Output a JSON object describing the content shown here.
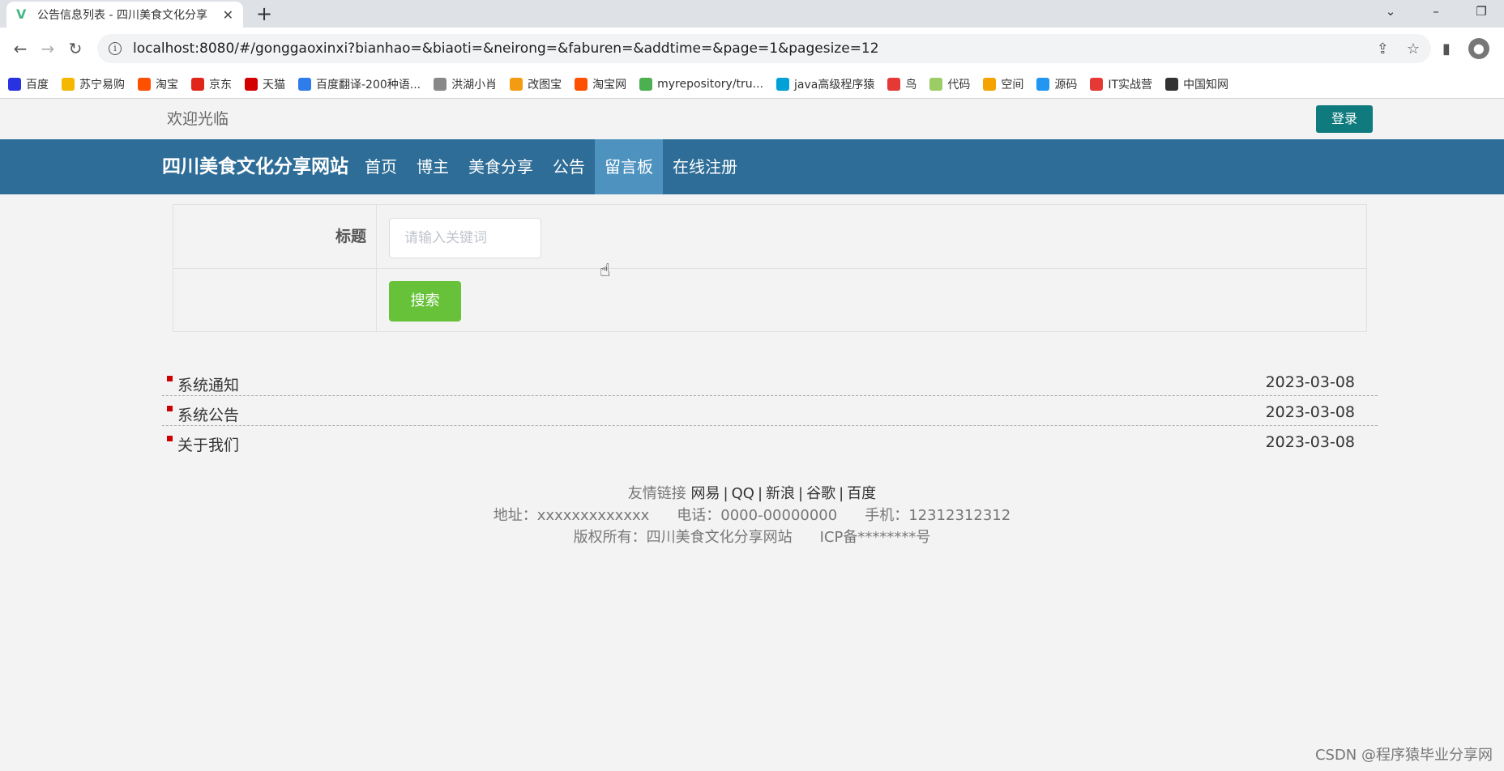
{
  "browser": {
    "tab_title": "公告信息列表 - 四川美食文化分享",
    "new_tab": "+",
    "url": "localhost:8080/#/gonggaoxinxi?bianhao=&biaoti=&neirong=&faburen=&addtime=&page=1&pagesize=12",
    "bookmarks": [
      {
        "label": "百度",
        "color": "#2932e1",
        "icon": "baidu-icon"
      },
      {
        "label": "苏宁易购",
        "color": "#f5b800",
        "icon": "suning-icon"
      },
      {
        "label": "淘宝",
        "color": "#ff5000",
        "icon": "taobao-icon"
      },
      {
        "label": "京东",
        "color": "#e1251b",
        "icon": "jd-icon"
      },
      {
        "label": "天猫",
        "color": "#d40000",
        "icon": "tmall-icon"
      },
      {
        "label": "百度翻译-200种语...",
        "color": "#2f7dea",
        "icon": "translate-icon"
      },
      {
        "label": "洪湖小肖",
        "color": "#888888",
        "icon": "bird-icon"
      },
      {
        "label": "改图宝",
        "color": "#f39c12",
        "icon": "gaitubao-icon"
      },
      {
        "label": "淘宝网",
        "color": "#ff5000",
        "icon": "taobao-icon"
      },
      {
        "label": "myrepository/tru...",
        "color": "#4caf50",
        "icon": "chrome-icon"
      },
      {
        "label": "java高级程序猿",
        "color": "#00a1d6",
        "icon": "bilibili-icon"
      },
      {
        "label": "鸟",
        "color": "#e53935",
        "icon": "bird-icon"
      },
      {
        "label": "代码",
        "color": "#9ccc65",
        "icon": "code-icon"
      },
      {
        "label": "空间",
        "color": "#f4a300",
        "icon": "space-icon"
      },
      {
        "label": "源码",
        "color": "#2196f3",
        "icon": "docker-icon"
      },
      {
        "label": "IT实战营",
        "color": "#e53935",
        "icon": "it-icon"
      },
      {
        "label": "中国知网",
        "color": "#333333",
        "icon": "cnki-icon"
      }
    ]
  },
  "header": {
    "welcome": "欢迎光临",
    "login": "登录"
  },
  "nav": {
    "brand": "四川美食文化分享网站",
    "items": [
      "首页",
      "博主",
      "美食分享",
      "公告",
      "留言板",
      "在线注册"
    ],
    "active_index": 4
  },
  "search": {
    "label": "标题",
    "placeholder": "请输入关键词",
    "button": "搜索"
  },
  "notices": [
    {
      "title": "系统通知",
      "date": "2023-03-08"
    },
    {
      "title": "系统公告",
      "date": "2023-03-08"
    },
    {
      "title": "关于我们",
      "date": "2023-03-08"
    }
  ],
  "footer": {
    "links_label": "友情链接",
    "links": [
      "网易",
      "QQ",
      "新浪",
      "谷歌",
      "百度"
    ],
    "address": "地址：xxxxxxxxxxxxx",
    "phone": "电话：0000-00000000",
    "mobile": "手机：12312312312",
    "copyright": "版权所有：四川美食文化分享网站",
    "icp": "ICP备********号"
  },
  "watermark": "CSDN @程序猿毕业分享网",
  "colors": {
    "navbar": "#2e6d97",
    "nav_active": "#4e93c0",
    "login_button": "#0f7b7e",
    "search_button": "#67c23a",
    "bullet": "#cc0000"
  }
}
